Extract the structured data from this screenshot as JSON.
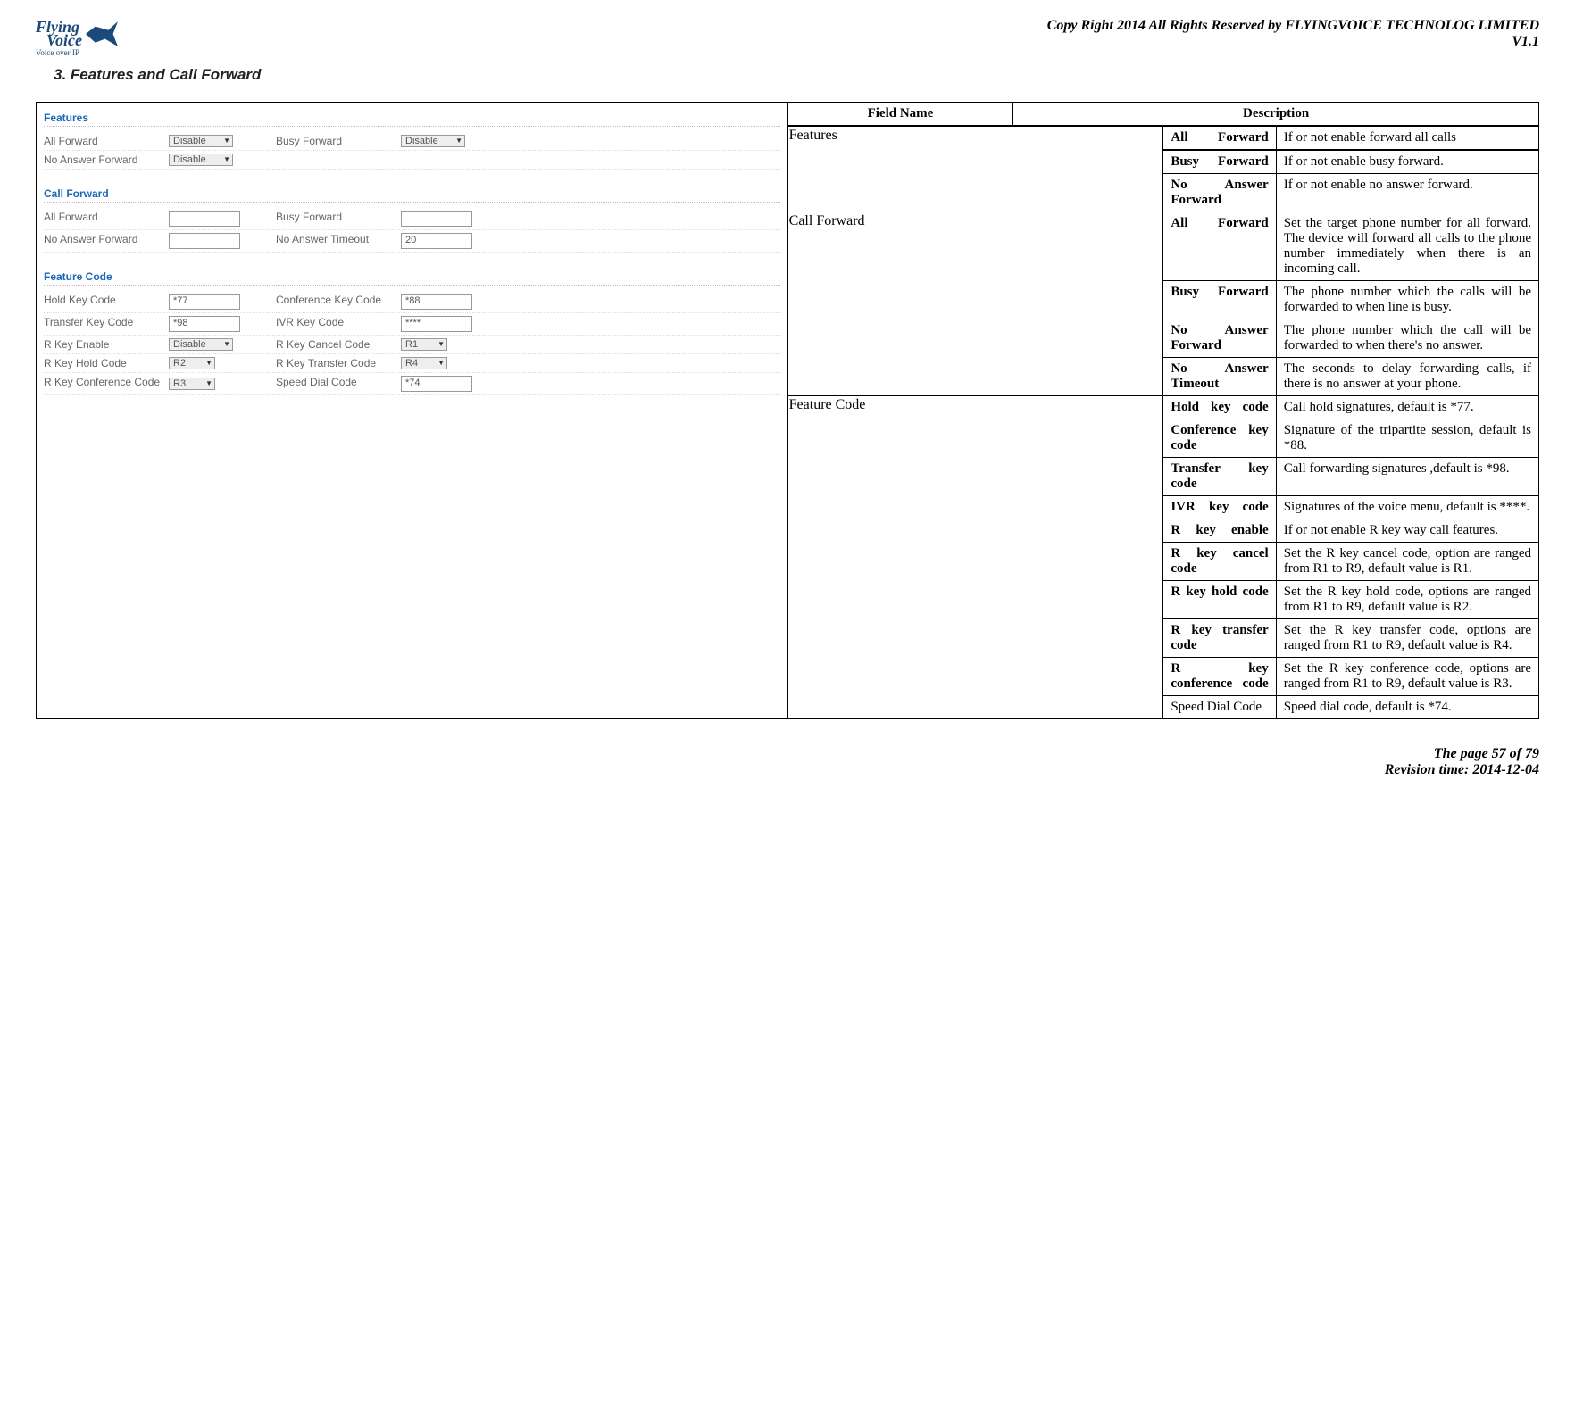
{
  "logo": {
    "line1": "Flying",
    "line2": "Voice",
    "sub": "Voice over IP"
  },
  "header": {
    "copyright": "Copy Right 2014 All Rights Reserved by FLYINGVOICE TECHNOLOG LIMITED",
    "version": "V1.1"
  },
  "section_title": "3.  Features and Call Forward",
  "screenshot": {
    "features": {
      "title": "Features",
      "all_forward": {
        "label": "All Forward",
        "value": "Disable"
      },
      "busy_forward": {
        "label": "Busy Forward",
        "value": "Disable"
      },
      "no_answer_forward": {
        "label": "No Answer Forward",
        "value": "Disable"
      }
    },
    "call_forward": {
      "title": "Call Forward",
      "all_forward": {
        "label": "All Forward",
        "value": ""
      },
      "busy_forward": {
        "label": "Busy Forward",
        "value": ""
      },
      "no_answer_forward": {
        "label": "No Answer Forward",
        "value": ""
      },
      "no_answer_timeout": {
        "label": "No Answer Timeout",
        "value": "20"
      }
    },
    "feature_code": {
      "title": "Feature Code",
      "hold_key_code": {
        "label": "Hold Key Code",
        "value": "*77"
      },
      "conference_key_code": {
        "label": "Conference Key Code",
        "value": "*88"
      },
      "transfer_key_code": {
        "label": "Transfer Key Code",
        "value": "*98"
      },
      "ivr_key_code": {
        "label": "IVR Key Code",
        "value": "****"
      },
      "r_key_enable": {
        "label": "R Key Enable",
        "value": "Disable"
      },
      "r_key_cancel_code": {
        "label": "R Key Cancel Code",
        "value": "R1"
      },
      "r_key_hold_code": {
        "label": "R Key Hold Code",
        "value": "R2"
      },
      "r_key_transfer_code": {
        "label": "R Key Transfer Code",
        "value": "R4"
      },
      "r_key_conference_code": {
        "label": "R Key Conference Code",
        "value": "R3"
      },
      "speed_dial_code": {
        "label": "Speed Dial Code",
        "value": "*74"
      }
    }
  },
  "table": {
    "headers": {
      "field_name": "Field Name",
      "description": "Description"
    },
    "sections": {
      "features": "Features",
      "call_forward": "Call Forward",
      "feature_code": "Feature Code"
    },
    "rows": {
      "f_all": {
        "name": "All Forward",
        "desc": "If or not enable forward all calls"
      },
      "f_busy": {
        "name": "Busy Forward",
        "desc": "If or not enable busy forward."
      },
      "f_noans": {
        "name": "No Answer Forward",
        "desc": "If or not enable no answer forward."
      },
      "c_all": {
        "name": "All Forward",
        "desc": "Set the target phone number for all forward. The device will forward all calls to the phone number immediately when there is an incoming call."
      },
      "c_busy": {
        "name": "Busy Forward",
        "desc": "The phone number which the calls will be forwarded to when line is busy."
      },
      "c_noans": {
        "name": "No Answer Forward",
        "desc": "The phone number which the call will be forwarded to when there's no answer."
      },
      "c_timeout": {
        "name": "No Answer Timeout",
        "desc": "The seconds to delay forwarding calls, if there is no answer at your phone."
      },
      "fc_hold": {
        "name": "Hold key code",
        "desc": "Call hold signatures, default is *77."
      },
      "fc_conf": {
        "name": "Conference key code",
        "desc": "Signature of the tripartite session, default is *88."
      },
      "fc_transfer": {
        "name": "Transfer key code",
        "desc": "Call forwarding signatures ,default is *98."
      },
      "fc_ivr": {
        "name": "IVR key code",
        "desc": "Signatures of the voice menu, default is ****."
      },
      "fc_rkey": {
        "name": "R key enable",
        "desc": "If or not enable R key way call features."
      },
      "fc_rcancel": {
        "name": "R key cancel code",
        "desc": "Set the R key cancel code, option are ranged from R1 to R9, default value is R1."
      },
      "fc_rhold": {
        "name": "R key hold code",
        "desc": "Set the R key hold code, options are ranged from R1 to R9, default value is R2."
      },
      "fc_rtransfer": {
        "name": "R key transfer code",
        "desc": "Set the R key transfer code, options are ranged from R1 to R9, default value is R4."
      },
      "fc_rconf": {
        "name": "R key conference code",
        "desc": "Set the R key conference code, options are ranged from R1 to R9, default value is R3."
      },
      "fc_speed": {
        "name": "Speed Dial Code",
        "desc": "Speed dial code, default is *74."
      }
    }
  },
  "footer": {
    "page": "The page 57 of 79",
    "revision": "Revision time: 2014-12-04"
  }
}
